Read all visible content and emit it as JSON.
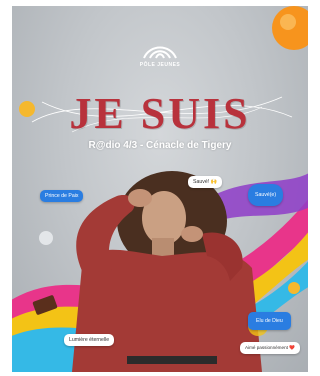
{
  "poster": {
    "organization": "PÔLE JEUNES",
    "headline": "JE SUIS",
    "subtitle": "R@dio 4/3 - Cénacle de Tigery",
    "bubbles": {
      "prince_de_paix": "Prince de Paix",
      "sauver": "Sauvé! 🙌",
      "blue_top_right": "Sauvé(e)",
      "lumiere_eternelle": "Lumière éternelle",
      "elu_de_dieu": "Elu de Dieu",
      "aime_passionnement": "Aimé passionnément ❤️"
    },
    "colors": {
      "headline": "#b8323c",
      "sweater": "#a33a36",
      "bubble_blue": "#2a7de1",
      "rainbow_pink": "#e8358a",
      "rainbow_yellow": "#f3c316",
      "rainbow_cyan": "#35b9e6"
    }
  }
}
